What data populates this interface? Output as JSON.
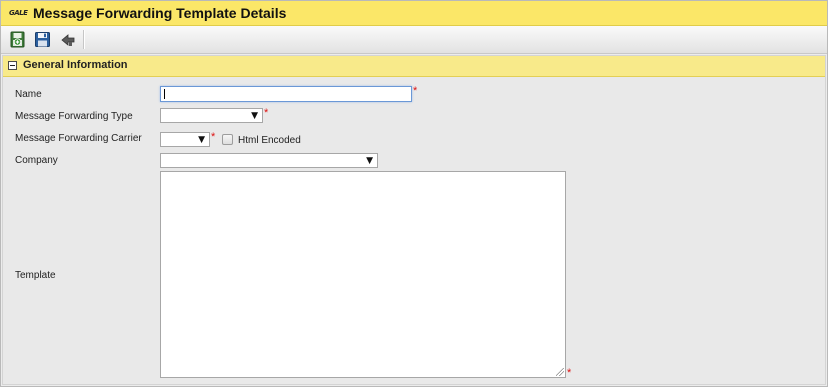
{
  "window": {
    "logo_text": "GALE",
    "title": "Message Forwarding Template Details"
  },
  "toolbar": {
    "buttons": [
      {
        "name": "save-and-new",
        "icon": "save-new-icon"
      },
      {
        "name": "save",
        "icon": "floppy-disk-icon"
      },
      {
        "name": "back",
        "icon": "back-arrow-icon"
      }
    ]
  },
  "section": {
    "title": "General Information"
  },
  "form": {
    "name_label": "Name",
    "name_value": "",
    "type_label": "Message Forwarding Type",
    "type_value": "",
    "carrier_label": "Message Forwarding Carrier",
    "carrier_value": "",
    "html_encoded_label": "Html Encoded",
    "html_encoded_checked": false,
    "company_label": "Company",
    "company_value": "",
    "template_label": "Template",
    "template_value": "",
    "required_mark": "*",
    "dropdown_arrow": "▼"
  },
  "colors": {
    "title_bar": "#fbe768",
    "section_header": "#f8ea8a",
    "required": "#dd1111"
  }
}
